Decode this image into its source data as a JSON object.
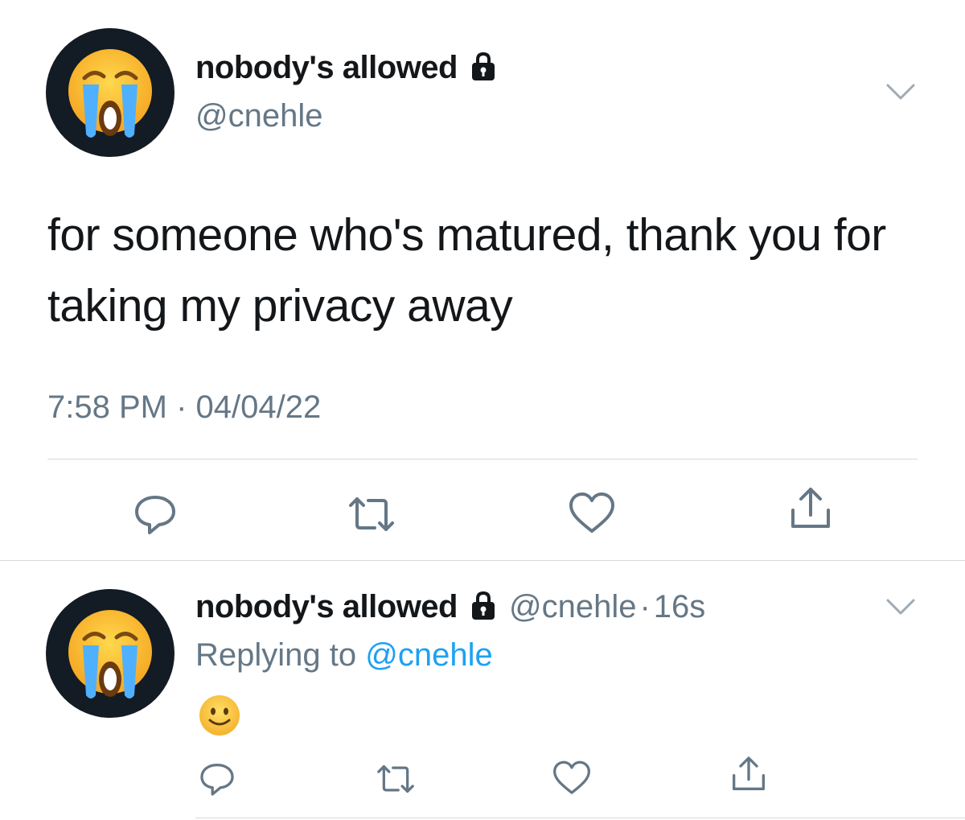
{
  "tweet": {
    "author_name": "nobody's allowed",
    "author_handle": "@cnehle",
    "text": "for someone who's matured, thank you for taking my privacy away",
    "timestamp": "7:58 PM · 04/04/22",
    "icons": {
      "avatar": "loudly-crying-face-emoji",
      "lock": "lock-icon",
      "more": "chevron-down-icon",
      "actions": [
        "reply-icon",
        "retweet-icon",
        "like-icon",
        "share-icon"
      ]
    }
  },
  "reply": {
    "author_name": "nobody's allowed",
    "author_handle": "@cnehle",
    "separator": "·",
    "age": "16s",
    "replying_prefix": "Replying to",
    "replying_to": "@cnehle",
    "content_emoji": "slightly-smiling-face-emoji"
  },
  "colors": {
    "text": "#14171a",
    "secondary": "#657786",
    "link": "#1da1f2",
    "avatar_bg": "#131b24",
    "divider": "#d6dadd"
  }
}
